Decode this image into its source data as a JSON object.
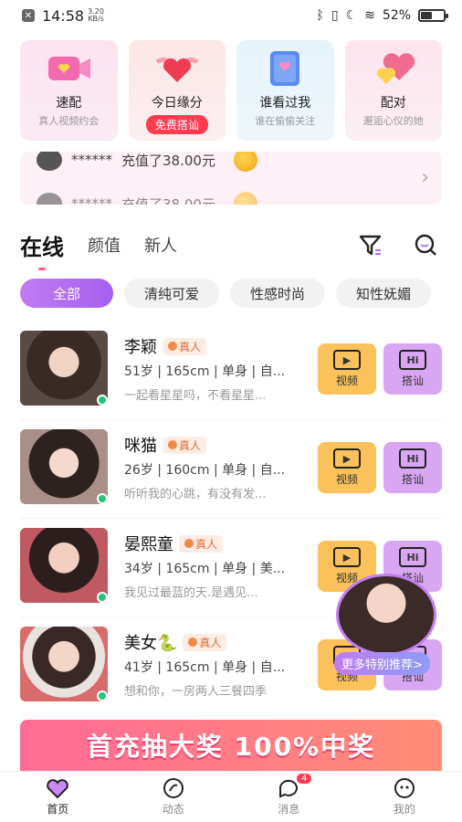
{
  "status_bar": {
    "time": "14:58",
    "network_speed": "3.20",
    "network_unit": "KB/s",
    "battery": "52%",
    "battery_level": 0.52
  },
  "features": [
    {
      "title": "速配",
      "subtitle": "真人视频约会",
      "icon": "video-heart-icon"
    },
    {
      "title": "今日缘分",
      "button": "免费搭讪",
      "icon": "winged-heart-icon"
    },
    {
      "title": "谁看过我",
      "subtitle": "谁在偷偷关注",
      "icon": "eye-book-icon"
    },
    {
      "title": "配对",
      "subtitle": "邂逅心仪的她",
      "icon": "double-heart-icon"
    }
  ],
  "ticker": {
    "items": [
      {
        "user": "******",
        "text": "充值了38.00元"
      },
      {
        "user": "******",
        "text": "充值了38.00元"
      }
    ]
  },
  "tabs": [
    {
      "label": "在线",
      "active": true
    },
    {
      "label": "颜值",
      "active": false
    },
    {
      "label": "新人",
      "active": false
    }
  ],
  "chips": [
    {
      "label": "全部",
      "active": true
    },
    {
      "label": "清纯可爱",
      "active": false
    },
    {
      "label": "性感时尚",
      "active": false
    },
    {
      "label": "知性妩媚",
      "active": false
    }
  ],
  "users": [
    {
      "name": "李颖",
      "badge": "真人",
      "meta": "51岁 | 165cm | 单身 | 自...",
      "bio": "一起看星星吗，不看星星...",
      "video": "视频",
      "hi": "搭讪",
      "hi_glyph": "Hi",
      "photo_bg": "#5a4a44"
    },
    {
      "name": "咪猫",
      "badge": "真人",
      "meta": "26岁 | 160cm | 单身 | 自...",
      "bio": "听听我的心跳，有没有发...",
      "video": "视频",
      "hi": "搭讪",
      "hi_glyph": "Hi",
      "photo_bg": "#8f6f6a"
    },
    {
      "name": "晏熙童",
      "badge": "真人",
      "meta": "34岁 | 165cm | 单身 | 美...",
      "bio": "我见过最蓝的天.是遇见...",
      "video": "视频",
      "hi": "搭讪",
      "hi_glyph": "Hi",
      "photo_bg": "#c05a62"
    },
    {
      "name": "美女🐍",
      "badge": "真人",
      "meta": "41岁 | 165cm | 单身 | 自...",
      "bio": "想和你，一房两人三餐四季",
      "video": "视频",
      "hi": "搭讪",
      "hi_glyph": "Hi",
      "photo_bg": "#d86b6b"
    }
  ],
  "floating": {
    "more_label": "更多特别推荐>"
  },
  "banner": {
    "text": "首充抽大奖 100%中奖"
  },
  "nav": [
    {
      "label": "首页",
      "active": true,
      "icon": "home-heart-icon"
    },
    {
      "label": "动态",
      "active": false,
      "icon": "moments-icon"
    },
    {
      "label": "消息",
      "active": false,
      "icon": "message-icon",
      "badge": "4"
    },
    {
      "label": "我的",
      "active": false,
      "icon": "profile-icon"
    }
  ],
  "colors": {
    "accent": "#a65ff0",
    "video_btn": "#fbc15a",
    "hi_btn": "#d9a6f3",
    "online": "#21c47a"
  }
}
